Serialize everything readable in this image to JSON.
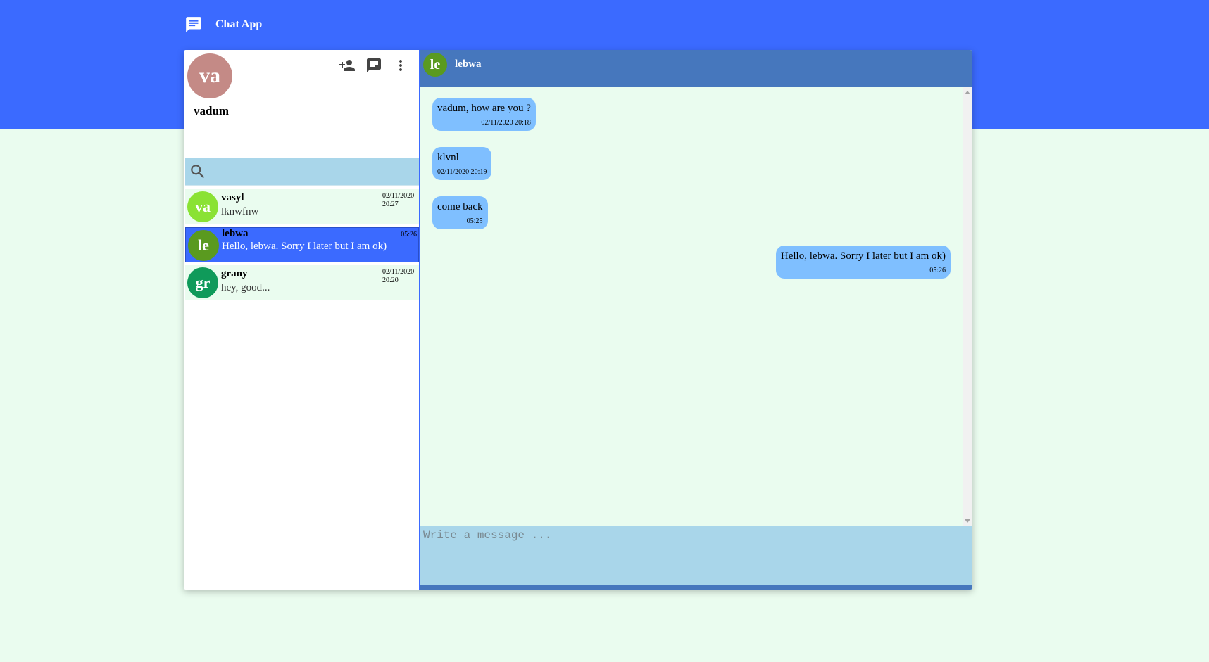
{
  "app": {
    "title": "Chat App",
    "icon": "chat-bubble-icon"
  },
  "colors": {
    "topbar": "#3b6aff",
    "background": "#eafcef",
    "header": "#4677bd",
    "bubble": "#7fbfff",
    "search": "#a9d6ea",
    "active_contact": "#3b6aff"
  },
  "me": {
    "initials": "va",
    "name": "vadum",
    "avatar_color": "#c48a86"
  },
  "toolbar": {
    "add_contact_icon": "person-add-icon",
    "new_chat_icon": "chat-icon",
    "menu_icon": "more-vert-icon"
  },
  "search": {
    "placeholder": "",
    "value": ""
  },
  "contacts": [
    {
      "initials": "va",
      "name": "vasyl",
      "preview": "lknwfnw",
      "time": "02/11/2020 20:27",
      "avatar_color": "#8ae234",
      "active": false
    },
    {
      "initials": "le",
      "name": "lebwa",
      "preview": "Hello, lebwa. Sorry I later but I am ok)",
      "time": "05:26",
      "avatar_color": "#5a9a1f",
      "active": true
    },
    {
      "initials": "gr",
      "name": "grany",
      "preview": "hey, good...",
      "time": "02/11/2020 20:20",
      "avatar_color": "#0f9a5a",
      "active": false
    }
  ],
  "chat": {
    "initials": "le",
    "name": "lebwa",
    "avatar_color": "#5a9a1f",
    "messages": [
      {
        "text": "vadum, how are you ?",
        "time": "02/11/2020 20:18",
        "side": "left"
      },
      {
        "text": "klvnl",
        "time": "02/11/2020 20:19",
        "side": "left"
      },
      {
        "text": "come back",
        "time": "05:25",
        "side": "left"
      },
      {
        "text": "Hello, lebwa. Sorry I later but I am ok)",
        "time": "05:26",
        "side": "right"
      }
    ]
  },
  "composer": {
    "placeholder": "Write a message ...",
    "value": ""
  }
}
